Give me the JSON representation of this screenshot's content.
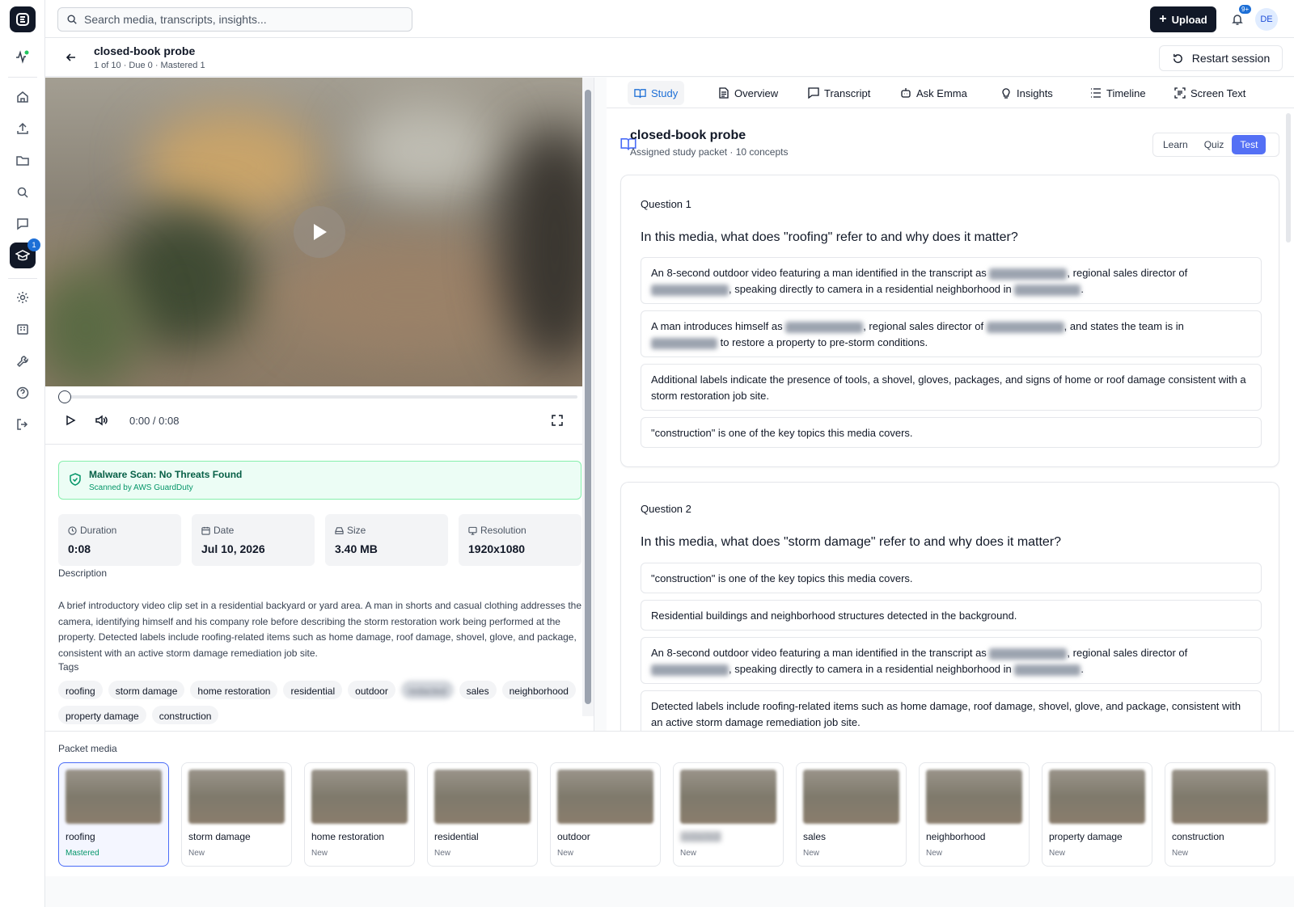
{
  "search": {
    "placeholder": "Search media, transcripts, insights..."
  },
  "topbar": {
    "upload_label": "Upload",
    "notif_count": "9+",
    "avatar_initials": "DE"
  },
  "rail": {
    "study_badge": "1"
  },
  "session": {
    "title": "closed-book probe",
    "subtitle": "1 of 10 · Due 0 · Mastered 1",
    "restart_label": "Restart session"
  },
  "player": {
    "time": "0:00 / 0:08"
  },
  "scan": {
    "title": "Malware Scan: No Threats Found",
    "subtitle": "Scanned by AWS GuardDuty"
  },
  "meta": [
    {
      "label": "Duration",
      "value": "0:08"
    },
    {
      "label": "Date",
      "value": "Jul 10, 2026"
    },
    {
      "label": "Size",
      "value": "3.40 MB"
    },
    {
      "label": "Resolution",
      "value": "1920x1080"
    }
  ],
  "description": {
    "label": "Description",
    "text": "A brief introductory video clip set in a residential backyard or yard area. A man in shorts and casual clothing addresses the camera, identifying himself and his company role before describing the storm restoration work being performed at the property. Detected labels include roofing-related items such as home damage, roof damage, shovel, glove, and package, consistent with an active storm damage remediation job site."
  },
  "tags": {
    "label": "Tags",
    "items": [
      "roofing",
      "storm damage",
      "home restoration",
      "residential",
      "outdoor",
      "redacted",
      "sales",
      "neighborhood",
      "property damage",
      "construction"
    ]
  },
  "tabs": [
    "Study",
    "Overview",
    "Transcript",
    "Ask Emma",
    "Insights",
    "Timeline",
    "Screen Text"
  ],
  "study": {
    "title": "closed-book probe",
    "subtitle": "Assigned study packet · 10 concepts",
    "modes": [
      "Learn",
      "Quiz",
      "Test"
    ]
  },
  "questions": [
    {
      "number": "Question 1",
      "text": "In this media, what does \"roofing\" refer to and why does it matter?",
      "options": [
        {
          "a": "An 8-second outdoor video featuring a man identified in the transcript as ",
          "b": ", regional sales director of ",
          "c": ", speaking directly to camera in a residential neighborhood in ",
          "d": "."
        },
        {
          "a": "A man introduces himself as ",
          "b": ", regional sales director of ",
          "c": ", and states the team is in ",
          "d": " to restore a property to pre-storm conditions."
        },
        {
          "a": "Additional labels indicate the presence of tools, a shovel, gloves, packages, and signs of home or roof damage consistent with a storm restoration job site."
        },
        {
          "a": "\"construction\" is one of the key topics this media covers."
        }
      ]
    },
    {
      "number": "Question 2",
      "text": "In this media, what does \"storm damage\" refer to and why does it matter?",
      "options": [
        {
          "a": "\"construction\" is one of the key topics this media covers."
        },
        {
          "a": "Residential buildings and neighborhood structures detected in the background."
        },
        {
          "a": "An 8-second outdoor video featuring a man identified in the transcript as ",
          "b": ", regional sales director of ",
          "c": ", speaking directly to camera in a residential neighborhood in ",
          "d": "."
        },
        {
          "a": "Detected labels include roofing-related items such as home damage, roof damage, shovel, glove, and package, consistent with an active storm damage remediation job site."
        }
      ]
    }
  ],
  "packet": {
    "label": "Packet media",
    "items": [
      {
        "name": "roofing",
        "status": "Mastered"
      },
      {
        "name": "storm damage",
        "status": "New"
      },
      {
        "name": "home restoration",
        "status": "New"
      },
      {
        "name": "residential",
        "status": "New"
      },
      {
        "name": "outdoor",
        "status": "New"
      },
      {
        "name": "redacted",
        "status": "New"
      },
      {
        "name": "sales",
        "status": "New"
      },
      {
        "name": "neighborhood",
        "status": "New"
      },
      {
        "name": "property damage",
        "status": "New"
      },
      {
        "name": "construction",
        "status": "New"
      }
    ]
  }
}
